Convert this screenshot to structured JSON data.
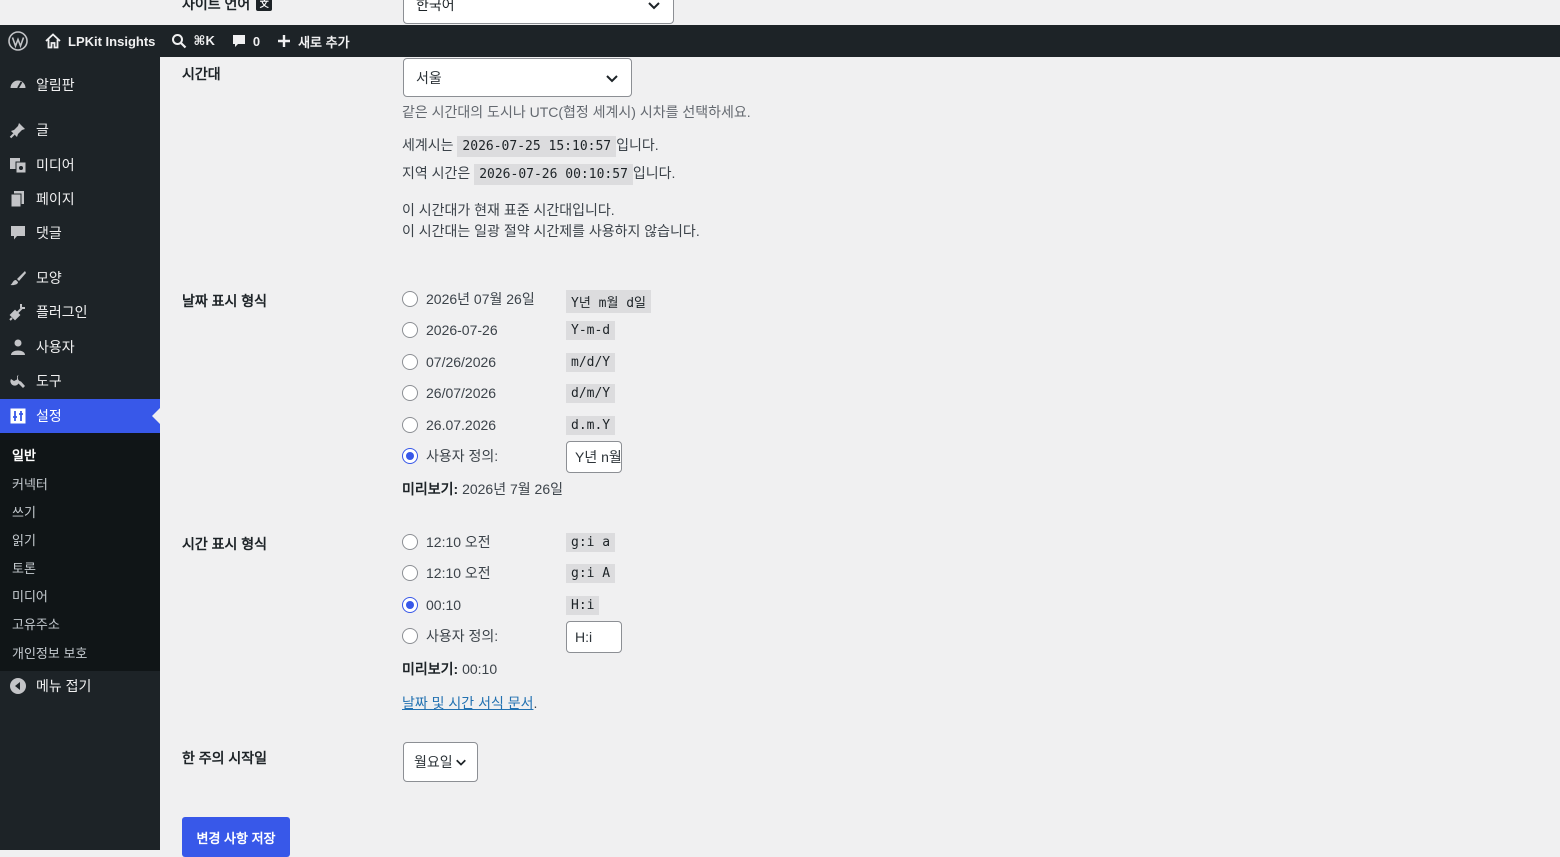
{
  "top_row": {
    "label": "사이트 언어",
    "language_select": "한국어"
  },
  "admin_bar": {
    "site_name": "LPKit Insights",
    "search_shortcut": "⌘K",
    "comments_count": "0",
    "new_label": "새로 추가"
  },
  "sidebar": {
    "items": [
      {
        "label": "알림판",
        "icon": "dashboard-icon"
      },
      {
        "label": "글",
        "icon": "pin-icon"
      },
      {
        "label": "미디어",
        "icon": "media-icon"
      },
      {
        "label": "페이지",
        "icon": "page-icon"
      },
      {
        "label": "댓글",
        "icon": "comment-icon"
      },
      {
        "label": "모양",
        "icon": "brush-icon"
      },
      {
        "label": "플러그인",
        "icon": "plugin-icon"
      },
      {
        "label": "사용자",
        "icon": "user-icon"
      },
      {
        "label": "도구",
        "icon": "wrench-icon"
      },
      {
        "label": "설정",
        "icon": "settings-icon"
      }
    ],
    "submenu": [
      "일반",
      "커넥터",
      "쓰기",
      "읽기",
      "토론",
      "미디어",
      "고유주소",
      "개인정보 보호"
    ],
    "collapse_label": "메뉴 접기"
  },
  "timezone": {
    "label": "시간대",
    "selected": "서울",
    "description": "같은 시간대의 도시나 UTC(협정 세계시) 시차를 선택하세요.",
    "utc_prefix": "세계시는",
    "utc_time": "2026-07-25 15:10:57",
    "utc_suffix": "입니다.",
    "local_prefix": "지역 시간은",
    "local_time": "2026-07-26 00:10:57",
    "local_suffix": "입니다.",
    "note1": "이 시간대가 현재 표준 시간대입니다.",
    "note2": "이 시간대는 일광 절약 시간제를 사용하지 않습니다."
  },
  "date_format": {
    "label": "날짜 표시 형식",
    "options": [
      {
        "label": "2026년 07월 26일",
        "format": "Y년 m월 d일",
        "checked": false
      },
      {
        "label": "2026-07-26",
        "format": "Y-m-d",
        "checked": false
      },
      {
        "label": "07/26/2026",
        "format": "m/d/Y",
        "checked": false
      },
      {
        "label": "26/07/2026",
        "format": "d/m/Y",
        "checked": false
      },
      {
        "label": "26.07.2026",
        "format": "d.m.Y",
        "checked": false
      }
    ],
    "custom_label": "사용자 정의:",
    "custom_value": "Y년 n월 j일",
    "custom_checked": true,
    "preview_label": "미리보기:",
    "preview_value": "2026년 7월 26일"
  },
  "time_format": {
    "label": "시간 표시 형식",
    "options": [
      {
        "label": "12:10 오전",
        "format": "g:i a",
        "checked": false
      },
      {
        "label": "12:10 오전",
        "format": "g:i A",
        "checked": false
      },
      {
        "label": "00:10",
        "format": "H:i",
        "checked": true
      }
    ],
    "custom_label": "사용자 정의:",
    "custom_value": "H:i",
    "custom_checked": false,
    "preview_label": "미리보기:",
    "preview_value": "00:10",
    "doc_link": "날짜 및 시간 서식 문서",
    "doc_suffix": "."
  },
  "week_start": {
    "label": "한 주의 시작일",
    "selected": "월요일"
  },
  "save_button": "변경 사항 저장",
  "colors": {
    "accent": "#3858e9",
    "sidebar_bg": "#1d2327",
    "page_bg": "#f0f0f1"
  }
}
